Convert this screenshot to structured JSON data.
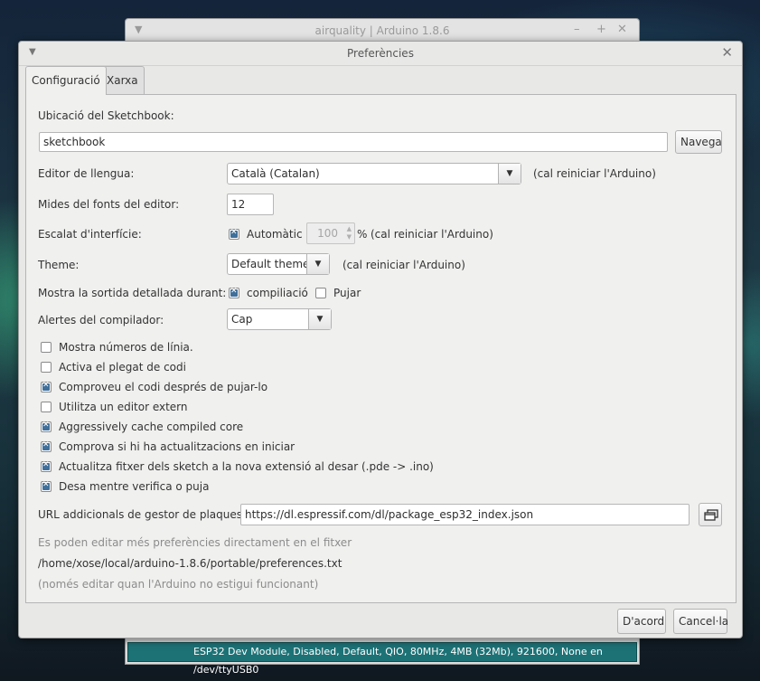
{
  "background_window": {
    "title": "airquality | Arduino 1.8.6",
    "status_bar": "ESP32 Dev Module, Disabled, Default, QIO, 80MHz, 4MB (32Mb), 921600, None en /dev/ttyUSB0"
  },
  "dialog": {
    "title": "Preferències",
    "tabs": [
      {
        "label": "Configuració"
      },
      {
        "label": "Xarxa"
      }
    ],
    "sketchbook": {
      "label": "Ubicació del Sketchbook:",
      "value": "sketchbook",
      "browse_label": "Navega"
    },
    "language": {
      "label": "Editor de llengua:",
      "value": "Català (Catalan)",
      "note": "(cal reiniciar l'Arduino)"
    },
    "font_size": {
      "label": "Mides del fonts del editor:",
      "value": "12"
    },
    "scaling": {
      "label": "Escalat d'interfície:",
      "auto_label": "Automàtic",
      "auto_checked": true,
      "value": "100",
      "unit": "%",
      "note": "(cal reiniciar l'Arduino)"
    },
    "theme": {
      "label": "Theme:",
      "value": "Default theme",
      "note": "(cal reiniciar l'Arduino)"
    },
    "verbose": {
      "label": "Mostra la sortida detallada durant:",
      "compile_label": "compiliació",
      "compile_checked": true,
      "upload_label": "Pujar",
      "upload_checked": false
    },
    "warnings": {
      "label": "Alertes del compilador:",
      "value": "Cap"
    },
    "options": [
      {
        "label": "Mostra números de línia.",
        "checked": false
      },
      {
        "label": "Activa el plegat de codi",
        "checked": false
      },
      {
        "label": "Comproveu el codi després de pujar-lo",
        "checked": true
      },
      {
        "label": "Utilitza un editor extern",
        "checked": false
      },
      {
        "label": "Aggressively cache compiled core",
        "checked": true
      },
      {
        "label": "Comprova si hi ha actualitzacions en iniciar",
        "checked": true
      },
      {
        "label": "Actualitza fitxer dels sketch a la nova extensió al desar (.pde -> .ino)",
        "checked": true
      },
      {
        "label": "Desa mentre verifica o puja",
        "checked": true
      }
    ],
    "boards_url": {
      "label": "URL addicionals de gestor de plaques:",
      "value": "https://dl.espressif.com/dl/package_esp32_index.json"
    },
    "footer": {
      "hint": "Es poden editar més preferències directament en el fitxer",
      "path": "/home/xose/local/arduino-1.8.6/portable/preferences.txt",
      "note": "(només editar quan l'Arduino no estigui funcionant)"
    },
    "ok_label": "D'acord",
    "cancel_label": "Cancel·la"
  }
}
